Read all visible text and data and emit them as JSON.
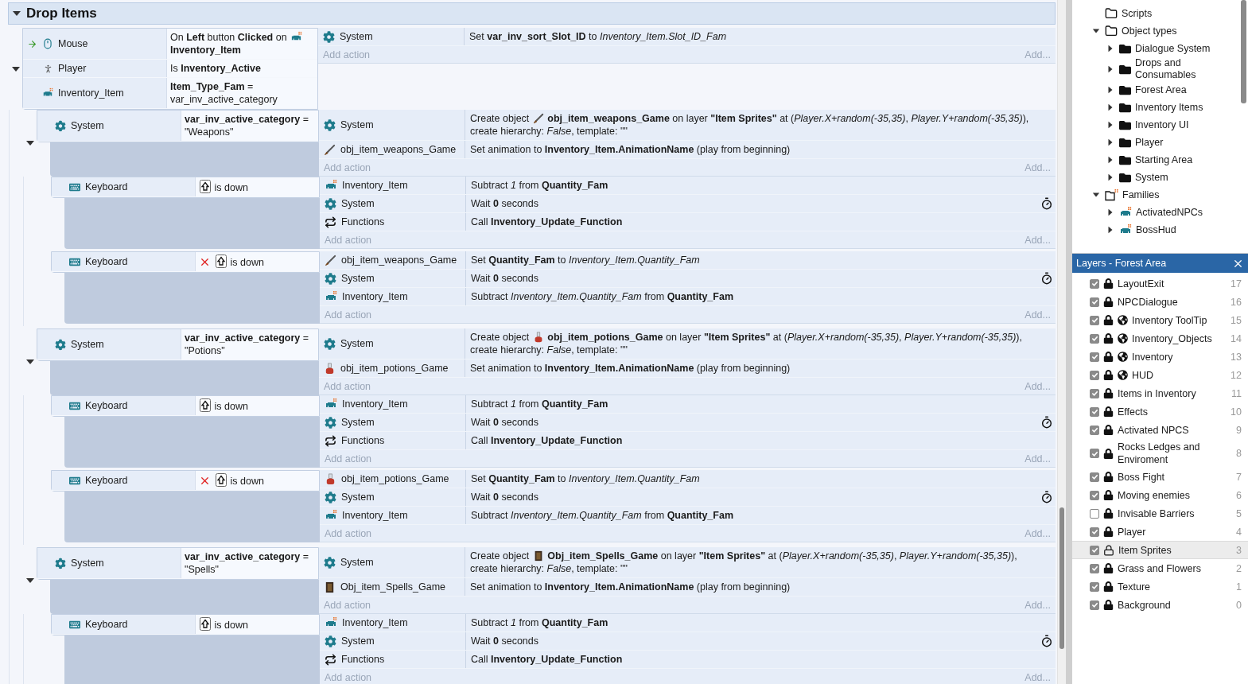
{
  "group": {
    "title": "Drop Items",
    "expanded": true,
    "events": [
      {
        "expanded": true,
        "add_action": "Add action",
        "add_more": "Add...",
        "conditions": [
          {
            "kind": "mouse",
            "object": "Mouse",
            "trigger": true,
            "inverted": false,
            "text": [
              "On **Left** button **Clicked** on ",
              {
                "kind": "family"
              },
              "**Inventory_Item**"
            ]
          },
          {
            "kind": "person",
            "object": "Player",
            "trigger": false,
            "inverted": false,
            "text": [
              "Is **Inventory_Active**"
            ]
          },
          {
            "kind": "family",
            "object": "Inventory_Item",
            "trigger": false,
            "inverted": false,
            "text": [
              "**Item_Type_Fam** = var_inv_active_category"
            ]
          }
        ],
        "actions": [
          {
            "kind": "gear",
            "object": "System",
            "timer": false,
            "text": [
              "Set **var_inv_sort_Slot_ID** to *Inventory_Item.Slot_ID_Fam*"
            ]
          }
        ],
        "children": [
          {
            "expanded": true,
            "add_action": "Add action",
            "add_more": "Add...",
            "conditions": [
              {
                "kind": "gear",
                "object": "System",
                "inverted": false,
                "text": [
                  "**var_inv_active_category** = \"Weapons\""
                ]
              }
            ],
            "actions": [
              {
                "kind": "gear",
                "object": "System",
                "timer": false,
                "text": [
                  "Create object ",
                  {
                    "kind": "sword"
                  },
                  " **obj_item_weapons_Game** on layer **\"Item Sprites\"** at (*Player.X+random(-35,35)*, *Player.Y+random(-35,35)*), create hierarchy: *False*, template: \"\""
                ]
              },
              {
                "kind": "sword",
                "object": "obj_item_weapons_Game",
                "timer": false,
                "text": [
                  "Set animation to **Inventory_Item.AnimationName** (play from beginning)"
                ]
              }
            ],
            "children": [
              {
                "add_action": "Add action",
                "add_more": "Add...",
                "conditions": [
                  {
                    "kind": "keyboard",
                    "object": "Keyboard",
                    "inverted": false,
                    "text": [
                      {
                        "kind": "shift"
                      },
                      " is down"
                    ]
                  }
                ],
                "actions": [
                  {
                    "kind": "family",
                    "object": "Inventory_Item",
                    "timer": false,
                    "text": [
                      "Subtract *1* from **Quantity_Fam**"
                    ]
                  },
                  {
                    "kind": "gear",
                    "object": "System",
                    "timer": true,
                    "text": [
                      "Wait **0** seconds"
                    ]
                  },
                  {
                    "kind": "functions",
                    "object": "Functions",
                    "timer": false,
                    "text": [
                      "Call **Inventory_Update_Function**"
                    ]
                  }
                ]
              },
              {
                "add_action": "Add action",
                "add_more": "Add...",
                "conditions": [
                  {
                    "kind": "keyboard",
                    "object": "Keyboard",
                    "inverted": true,
                    "text": [
                      {
                        "kind": "shift"
                      },
                      " is down"
                    ]
                  }
                ],
                "actions": [
                  {
                    "kind": "sword",
                    "object": "obj_item_weapons_Game",
                    "timer": false,
                    "text": [
                      "Set **Quantity_Fam** to *Inventory_Item.Quantity_Fam*"
                    ]
                  },
                  {
                    "kind": "gear",
                    "object": "System",
                    "timer": true,
                    "text": [
                      "Wait **0** seconds"
                    ]
                  },
                  {
                    "kind": "family",
                    "object": "Inventory_Item",
                    "timer": false,
                    "text": [
                      "Subtract *Inventory_Item.Quantity_Fam* from **Quantity_Fam**"
                    ]
                  }
                ]
              }
            ]
          },
          {
            "expanded": true,
            "add_action": "Add action",
            "add_more": "Add...",
            "conditions": [
              {
                "kind": "gear",
                "object": "System",
                "inverted": false,
                "text": [
                  "**var_inv_active_category** = \"Potions\""
                ]
              }
            ],
            "actions": [
              {
                "kind": "gear",
                "object": "System",
                "timer": false,
                "text": [
                  "Create object ",
                  {
                    "kind": "potion"
                  },
                  " **obj_item_potions_Game** on layer **\"Item Sprites\"** at (*Player.X+random(-35,35)*, *Player.Y+random(-35,35)*), create hierarchy: *False*, template: \"\""
                ]
              },
              {
                "kind": "potion",
                "object": "obj_item_potions_Game",
                "timer": false,
                "text": [
                  "Set animation to **Inventory_Item.AnimationName** (play from beginning)"
                ]
              }
            ],
            "children": [
              {
                "add_action": "Add action",
                "add_more": "Add...",
                "conditions": [
                  {
                    "kind": "keyboard",
                    "object": "Keyboard",
                    "inverted": false,
                    "text": [
                      {
                        "kind": "shift"
                      },
                      " is down"
                    ]
                  }
                ],
                "actions": [
                  {
                    "kind": "family",
                    "object": "Inventory_Item",
                    "timer": false,
                    "text": [
                      "Subtract *1* from **Quantity_Fam**"
                    ]
                  },
                  {
                    "kind": "gear",
                    "object": "System",
                    "timer": true,
                    "text": [
                      "Wait **0** seconds"
                    ]
                  },
                  {
                    "kind": "functions",
                    "object": "Functions",
                    "timer": false,
                    "text": [
                      "Call **Inventory_Update_Function**"
                    ]
                  }
                ]
              },
              {
                "add_action": "Add action",
                "add_more": "Add...",
                "conditions": [
                  {
                    "kind": "keyboard",
                    "object": "Keyboard",
                    "inverted": true,
                    "text": [
                      {
                        "kind": "shift"
                      },
                      " is down"
                    ]
                  }
                ],
                "actions": [
                  {
                    "kind": "potion",
                    "object": "obj_item_potions_Game",
                    "timer": false,
                    "text": [
                      "Set **Quantity_Fam** to *Inventory_Item.Quantity_Fam*"
                    ]
                  },
                  {
                    "kind": "gear",
                    "object": "System",
                    "timer": true,
                    "text": [
                      "Wait **0** seconds"
                    ]
                  },
                  {
                    "kind": "family",
                    "object": "Inventory_Item",
                    "timer": false,
                    "text": [
                      "Subtract *Inventory_Item.Quantity_Fam* from **Quantity_Fam**"
                    ]
                  }
                ]
              }
            ]
          },
          {
            "expanded": true,
            "add_action": "Add action",
            "add_more": "Add...",
            "conditions": [
              {
                "kind": "gear",
                "object": "System",
                "inverted": false,
                "text": [
                  "**var_inv_active_category** = \"Spells\""
                ]
              }
            ],
            "actions": [
              {
                "kind": "gear",
                "object": "System",
                "timer": false,
                "text": [
                  "Create object ",
                  {
                    "kind": "book"
                  },
                  " **Obj_item_Spells_Game** on layer **\"Item Sprites\"** at (*Player.X+random(-35,35)*, *Player.Y+random(-35,35)*), create hierarchy: *False*, template: \"\""
                ]
              },
              {
                "kind": "book",
                "object": "Obj_item_Spells_Game",
                "timer": false,
                "text": [
                  "Set animation to **Inventory_Item.AnimationName** (play from beginning)"
                ]
              }
            ],
            "children": [
              {
                "add_action": "Add action",
                "add_more": "Add...",
                "conditions": [
                  {
                    "kind": "keyboard",
                    "object": "Keyboard",
                    "inverted": false,
                    "text": [
                      {
                        "kind": "shift"
                      },
                      " is down"
                    ]
                  }
                ],
                "actions": [
                  {
                    "kind": "family",
                    "object": "Inventory_Item",
                    "timer": false,
                    "text": [
                      "Subtract *1* from **Quantity_Fam**"
                    ]
                  },
                  {
                    "kind": "gear",
                    "object": "System",
                    "timer": true,
                    "text": [
                      "Wait **0** seconds"
                    ]
                  },
                  {
                    "kind": "functions",
                    "object": "Functions",
                    "timer": false,
                    "text": [
                      "Call **Inventory_Update_Function**"
                    ]
                  }
                ]
              }
            ]
          }
        ]
      }
    ]
  },
  "project": {
    "items": [
      {
        "kind": "folder",
        "label": "Scripts"
      },
      {
        "kind": "folder",
        "label": "Object types",
        "expanded": true,
        "children": [
          {
            "kind": "folder-filled",
            "label": "Dialogue System",
            "expanded": false
          },
          {
            "kind": "folder-filled",
            "label": "Drops and Consumables",
            "expanded": false
          },
          {
            "kind": "folder-filled",
            "label": "Forest Area",
            "expanded": false
          },
          {
            "kind": "folder-filled",
            "label": "Inventory Items",
            "expanded": false
          },
          {
            "kind": "folder-filled",
            "label": "Inventory UI",
            "expanded": false
          },
          {
            "kind": "folder-filled",
            "label": "Player",
            "expanded": false
          },
          {
            "kind": "folder-filled",
            "label": "Starting Area",
            "expanded": false
          },
          {
            "kind": "folder-filled",
            "label": "System",
            "expanded": false
          }
        ]
      },
      {
        "kind": "family-folder",
        "label": "Families",
        "expanded": true,
        "children": [
          {
            "kind": "family",
            "label": "ActivatedNPCs",
            "expanded": false
          },
          {
            "kind": "family",
            "label": "BossHud",
            "expanded": false
          }
        ]
      }
    ]
  },
  "layers": {
    "title": "Layers - Forest Area",
    "items": [
      {
        "name": "LayoutExit",
        "index": "17",
        "visible": true,
        "locked": true,
        "global": false,
        "selected": false
      },
      {
        "name": "NPCDialogue",
        "index": "16",
        "visible": true,
        "locked": true,
        "global": false,
        "selected": false
      },
      {
        "name": "Inventory ToolTip",
        "index": "15",
        "visible": true,
        "locked": true,
        "global": true,
        "selected": false
      },
      {
        "name": "Inventory_Objects",
        "index": "14",
        "visible": true,
        "locked": true,
        "global": true,
        "selected": false
      },
      {
        "name": "Inventory",
        "index": "13",
        "visible": true,
        "locked": true,
        "global": true,
        "selected": false
      },
      {
        "name": "HUD",
        "index": "12",
        "visible": true,
        "locked": true,
        "global": true,
        "selected": false
      },
      {
        "name": "Items in Inventory",
        "index": "11",
        "visible": true,
        "locked": true,
        "global": false,
        "selected": false
      },
      {
        "name": "Effects",
        "index": "10",
        "visible": true,
        "locked": true,
        "global": false,
        "selected": false
      },
      {
        "name": "Activated NPCS",
        "index": "9",
        "visible": true,
        "locked": true,
        "global": false,
        "selected": false
      },
      {
        "name": "Rocks Ledges and Enviroment",
        "index": "8",
        "visible": true,
        "locked": true,
        "global": false,
        "selected": false
      },
      {
        "name": "Boss Fight",
        "index": "7",
        "visible": true,
        "locked": true,
        "global": false,
        "selected": false
      },
      {
        "name": "Moving enemies",
        "index": "6",
        "visible": true,
        "locked": true,
        "global": false,
        "selected": false
      },
      {
        "name": "Invisable Barriers",
        "index": "5",
        "visible": false,
        "locked": true,
        "global": false,
        "selected": false
      },
      {
        "name": "Player",
        "index": "4",
        "visible": true,
        "locked": true,
        "global": false,
        "selected": false
      },
      {
        "name": "Item Sprites",
        "index": "3",
        "visible": true,
        "locked": false,
        "global": false,
        "selected": true
      },
      {
        "name": "Grass and Flowers",
        "index": "2",
        "visible": true,
        "locked": true,
        "global": false,
        "selected": false
      },
      {
        "name": "Texture",
        "index": "1",
        "visible": true,
        "locked": true,
        "global": false,
        "selected": false
      },
      {
        "name": "Background",
        "index": "0",
        "visible": true,
        "locked": true,
        "global": false,
        "selected": false
      }
    ]
  }
}
